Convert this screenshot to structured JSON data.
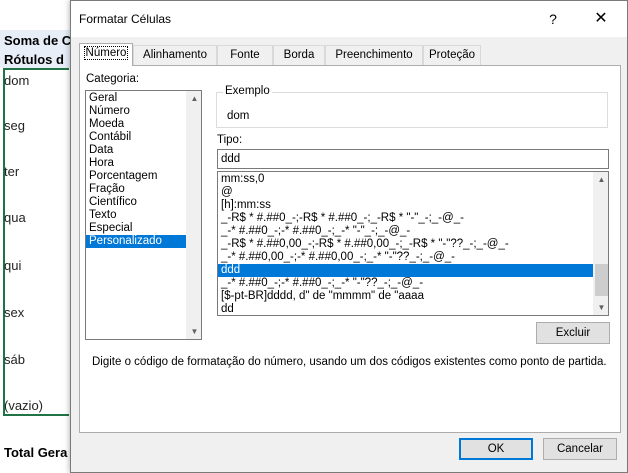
{
  "sheet": {
    "header1": "Soma de C",
    "header2": "Rótulos d",
    "rows": [
      "dom",
      "seg",
      "ter",
      "qua",
      "qui",
      "sex",
      "sáb",
      "(vazio)"
    ],
    "total": "Total Gera"
  },
  "dialog": {
    "title": "Formatar Células",
    "help": "?",
    "close": "✕",
    "tabs": [
      "Número",
      "Alinhamento",
      "Fonte",
      "Borda",
      "Preenchimento",
      "Proteção"
    ],
    "active_tab": "Número",
    "categoria_label": "Categoria:",
    "categories": [
      "Geral",
      "Número",
      "Moeda",
      "Contábil",
      "Data",
      "Hora",
      "Porcentagem",
      "Fração",
      "Científico",
      "Texto",
      "Especial",
      "Personalizado"
    ],
    "selected_category": "Personalizado",
    "exemplo_label": "Exemplo",
    "exemplo_value": "dom",
    "tipo_label": "Tipo:",
    "tipo_value": "ddd",
    "formats": [
      "mm:ss,0",
      "@",
      "[h]:mm:ss",
      "_-R$ * #.##0_-;-R$ * #.##0_-;_-R$ * \"-\"_-;_-@_-",
      "_-* #.##0_-;-* #.##0_-;_-* \"-\"_-;_-@_-",
      "_-R$ * #.##0,00_-;-R$ * #.##0,00_-;_-R$ * \"-\"??_-;_-@_-",
      "_-* #.##0,00_-;-* #.##0,00_-;_-* \"-\"??_-;_-@_-",
      "ddd",
      "_-* #.##0_-;-* #.##0_-;_-* \"-\"??_-;_-@_-",
      "[$-pt-BR]dddd, d\" de \"mmmm\" de \"aaaa",
      "dd"
    ],
    "selected_format": "ddd",
    "excluir": "Excluir",
    "hint": "Digite o código de formatação do número, usando um dos códigos existentes como ponto de partida.",
    "ok": "OK",
    "cancel": "Cancelar"
  }
}
